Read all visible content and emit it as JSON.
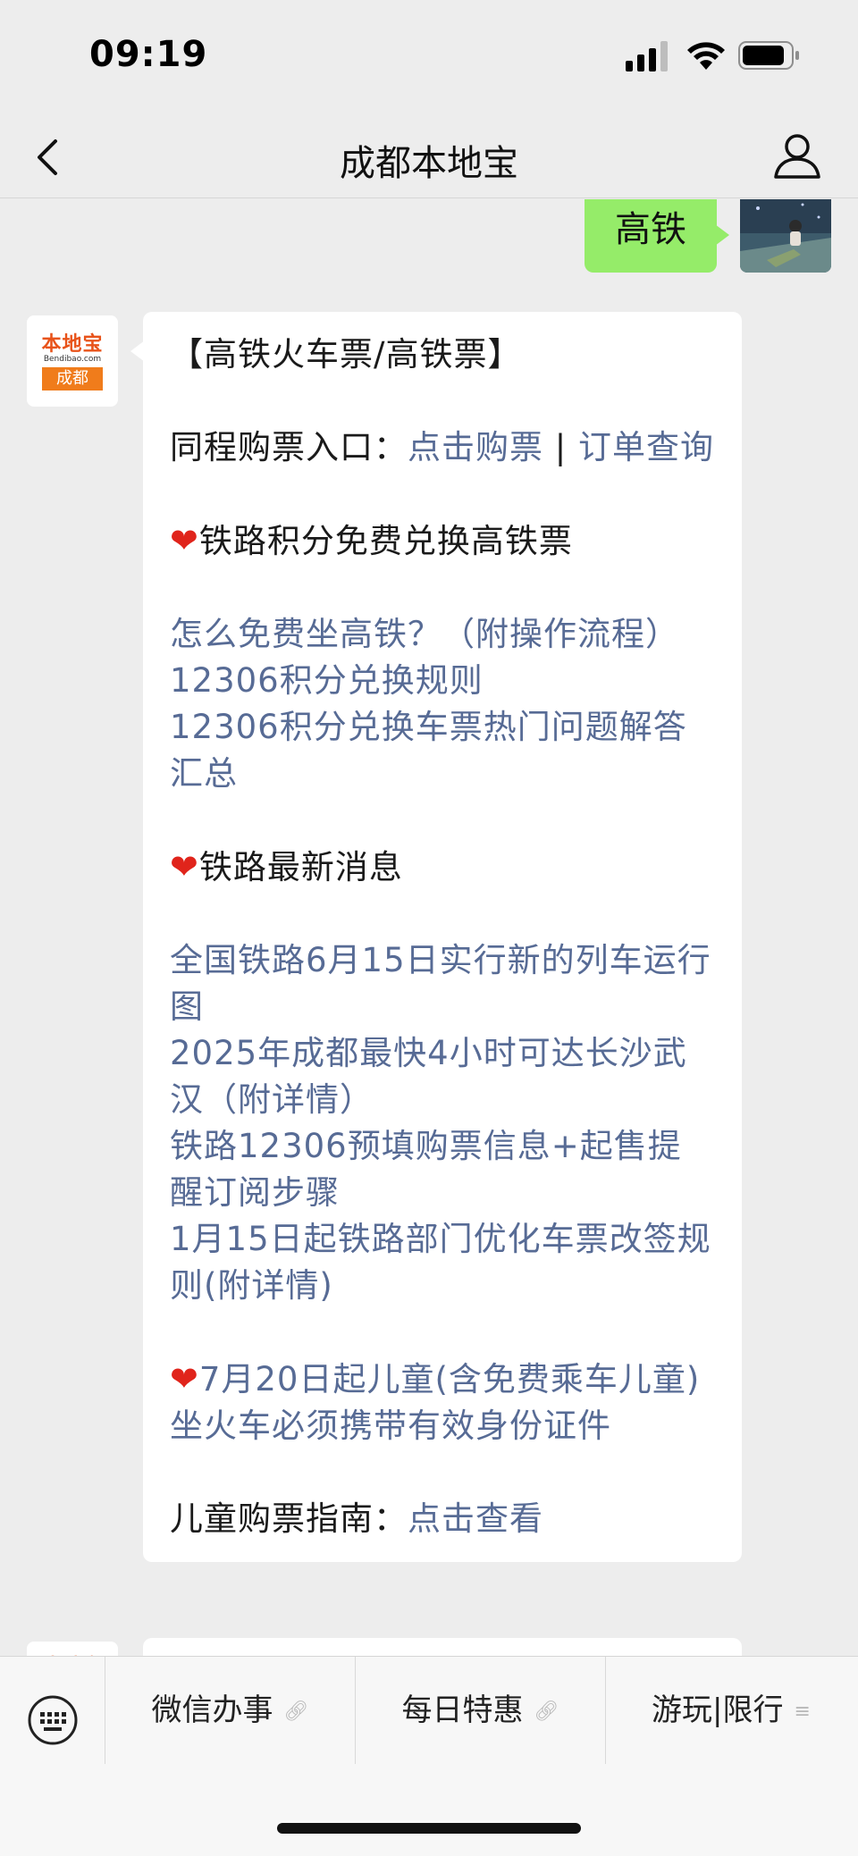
{
  "status_bar": {
    "time": "09:19"
  },
  "nav": {
    "title": "成都本地宝"
  },
  "user_message": {
    "text": "高铁"
  },
  "bot_avatar": {
    "brand": "本地宝",
    "domain": "Bendibao.com",
    "city": "成都"
  },
  "bot_message": {
    "header": "【高铁火车票/高铁票】",
    "purchase_label": "同程购票入口：",
    "purchase_link": "点击购票",
    "separator": " | ",
    "order_link": "订单查询",
    "section1_title": "铁路积分免费兑换高铁票",
    "section1_links": [
      "怎么免费坐高铁？（附操作流程）",
      "12306积分兑换规则",
      "12306积分兑换车票热门问题解答汇总"
    ],
    "section2_title": "铁路最新消息",
    "section2_links": [
      "全国铁路6月15日实行新的列车运行图",
      "2025年成都最快4小时可达长沙武汉（附详情）",
      "铁路12306预填购票信息+起售提醒订阅步骤",
      "1月15日起铁路部门优化车票改签规则(附详情)"
    ],
    "section3_title": "7月20日起儿童(含免费乘车儿童)坐火车必须携带有效身份证件",
    "children_label": "儿童购票指南：",
    "children_link": "点击查看"
  },
  "menu": {
    "items": [
      {
        "label": "微信办事",
        "icon": "link-icon"
      },
      {
        "label": "每日特惠",
        "icon": "link-icon"
      },
      {
        "label": "游玩|限行",
        "icon": "submenu-icon"
      }
    ]
  },
  "colors": {
    "link": "#576b95",
    "user_bubble": "#95ec69",
    "background": "#ededed",
    "heart": "#e0241b"
  }
}
